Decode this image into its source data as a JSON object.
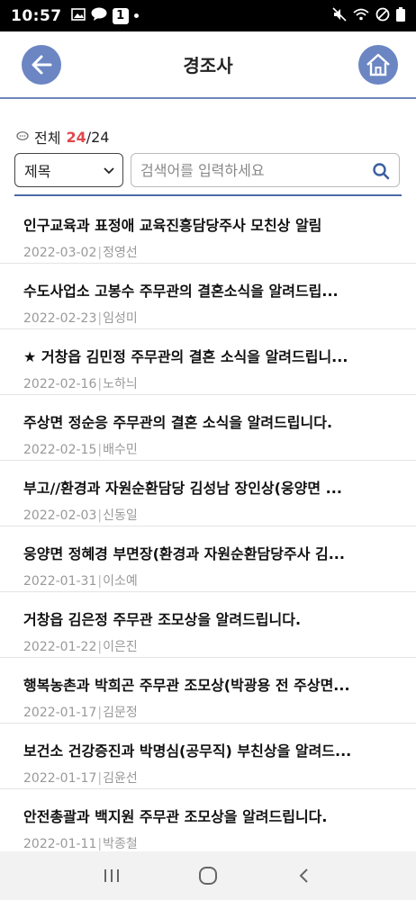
{
  "status": {
    "time": "10:57",
    "badge": "1"
  },
  "header": {
    "title": "경조사"
  },
  "count": {
    "label": "전체",
    "current": "24",
    "total": "/24"
  },
  "search": {
    "field_select": "제목",
    "placeholder": "검색어를 입력하세요"
  },
  "items": [
    {
      "title": "인구교육과 표정애 교육진흥담당주사 모친상 알림",
      "date": "2022-03-02",
      "author": "정영선"
    },
    {
      "title": "수도사업소 고봉수 주무관의 결혼소식을 알려드립...",
      "date": "2022-02-23",
      "author": "임성미"
    },
    {
      "title": "★ 거창읍 김민정 주무관의 결혼 소식을 알려드립니...",
      "date": "2022-02-16",
      "author": "노하늬"
    },
    {
      "title": "주상면 정순응 주무관의 결혼 소식을 알려드립니다.",
      "date": "2022-02-15",
      "author": "배수민"
    },
    {
      "title": "부고//환경과 자원순환담당 김성남 장인상(웅양면 ...",
      "date": "2022-02-03",
      "author": "신동일"
    },
    {
      "title": "웅양면 정혜경 부면장(환경과 자원순환담당주사 김...",
      "date": "2022-01-31",
      "author": "이소예"
    },
    {
      "title": "거창읍 김은정 주무관 조모상을 알려드립니다.",
      "date": "2022-01-22",
      "author": "이은진"
    },
    {
      "title": "행복농촌과 박희곤 주무관 조모상(박광용 전 주상면...",
      "date": "2022-01-17",
      "author": "김문정"
    },
    {
      "title": "보건소 건강증진과 박명심(공무직) 부친상을 알려드...",
      "date": "2022-01-17",
      "author": "김윤선"
    },
    {
      "title": "안전총괄과 백지원 주무관 조모상을 알려드립니다.",
      "date": "2022-01-11",
      "author": "박종철"
    }
  ],
  "colors": {
    "accent": "#6b86c3",
    "count_highlight": "#e0474c",
    "divider": "#4a6aa8"
  },
  "icons": {
    "back": "arrow-left-icon",
    "home": "home-icon",
    "search": "search-icon",
    "chat": "chat-bubble-icon"
  }
}
